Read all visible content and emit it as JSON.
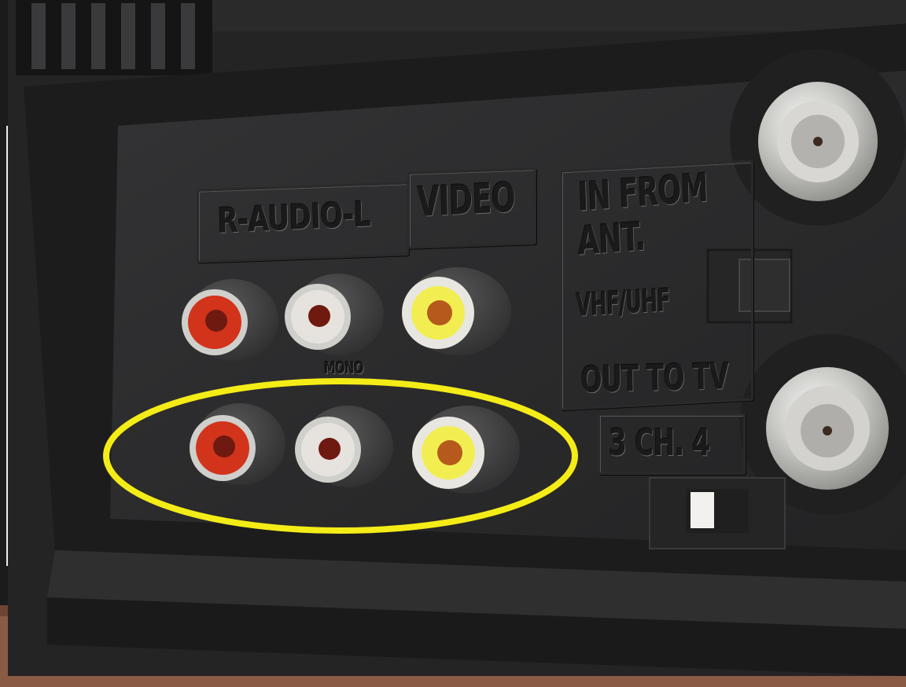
{
  "photo": {
    "description_labels": {
      "audio": "R-AUDIO-L",
      "video": "VIDEO",
      "in_from": "IN FROM",
      "ant": "ANT.",
      "band": "VHF/UHF",
      "out": "OUT TO TV",
      "channel": "3 CH. 4",
      "mono": "MONO"
    },
    "colors": {
      "panel": "#2d2d2e",
      "bezel": "#1f1f20",
      "highlight_ellipse": "#f4ec17",
      "jack_red": "#d2331b",
      "jack_white": "#e6e3de",
      "jack_yellow": "#f2ee52",
      "brick": "#8b5a45"
    }
  }
}
